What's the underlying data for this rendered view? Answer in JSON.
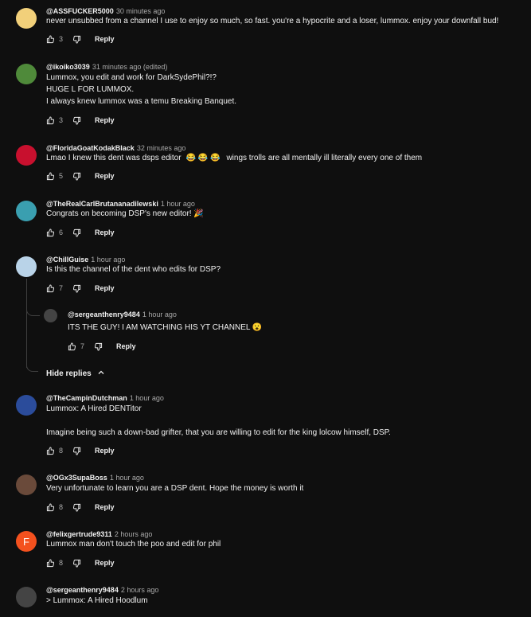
{
  "comments": [
    {
      "author": "@ASSFUCKER5000",
      "time": "30 minutes ago",
      "text": [
        "never unsubbed from a channel I use to enjoy so much, so fast. you're a hypocrite and a loser, lummox. enjoy your downfall bud!"
      ],
      "likes": "3",
      "reply": "Reply",
      "avatar_color": "#f2d07a"
    },
    {
      "author": "@ikoiko3039",
      "time": "31 minutes ago (edited)",
      "text": [
        "Lummox, you edit and work for DarkSydePhil?!?",
        "HUGE L FOR LUMMOX.",
        "I always knew lummox was a temu Breaking Banquet."
      ],
      "likes": "3",
      "reply": "Reply",
      "avatar_color": "#4f8a3a"
    },
    {
      "author": "@FloridaGoatKodakBlack",
      "time": "32 minutes ago",
      "text": [
        "Lmao I knew this dent was dsps editor",
        "wings trolls are all mentally ill literally every one of them"
      ],
      "likes": "5",
      "reply": "Reply",
      "avatar_color": "#c8102e"
    },
    {
      "author": "@TheRealCarlBrutananadilewski",
      "time": "1 hour ago",
      "text": [
        "Congrats on becoming DSP's new editor! 🎉"
      ],
      "likes": "6",
      "reply": "Reply",
      "avatar_color": "#3a9fb0"
    },
    {
      "author": "@ChillGuise",
      "time": "1 hour ago",
      "text": [
        "Is this the channel of the dent who edits for DSP?"
      ],
      "likes": "7",
      "reply": "Reply",
      "avatar_color": "#b9d3e8"
    },
    {
      "author": "@TheCampinDutchman",
      "time": "1 hour ago",
      "text": [
        "Lummox: A Hired DENTitor",
        "",
        "Imagine being such a down-bad grifter, that you are willing to edit for the king lolcow himself, DSP."
      ],
      "likes": "8",
      "reply": "Reply",
      "avatar_color": "#2b4c9b"
    },
    {
      "author": "@OGx3SupaBoss",
      "time": "1 hour ago",
      "text": [
        "Very unfortunate to learn you are a DSP dent. Hope the money is worth it"
      ],
      "likes": "8",
      "reply": "Reply",
      "avatar_color": "#6a4a3a"
    },
    {
      "author": "@felixgertrude9311",
      "time": "2 hours ago",
      "text": [
        "Lummox man don't touch the poo and edit for phil"
      ],
      "likes": "8",
      "reply": "Reply",
      "avatar_color": "#f4511e",
      "avatar_letter": "F"
    },
    {
      "author": "@sergeanthenry9484",
      "time": "2 hours ago",
      "text": [
        "> Lummox: A Hired Hoodlum"
      ],
      "avatar_color": "#444444"
    }
  ],
  "reply": {
    "author": "@sergeanthenry9484",
    "time": "1 hour ago",
    "text": "ITS THE GUY! I AM WATCHING HIS YT CHANNEL 😮",
    "likes": "7",
    "reply": "Reply",
    "avatar_color": "#444444"
  },
  "hide_replies": "Hide replies",
  "emoji_row": "😂 😂 😂"
}
